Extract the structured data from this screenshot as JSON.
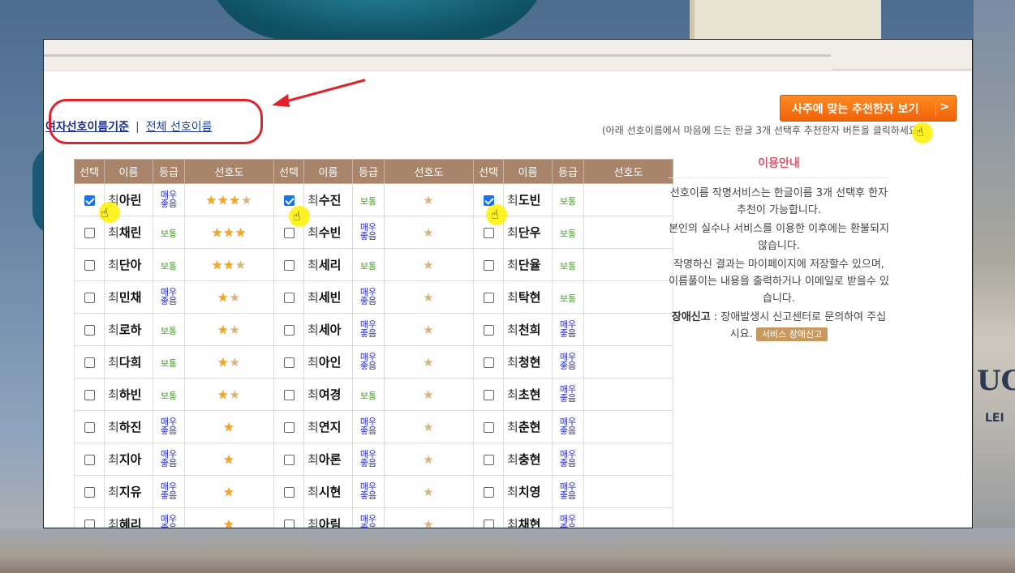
{
  "filter": {
    "current": "여자선호이름기준",
    "separator": "|",
    "all": "전체 선호이름"
  },
  "recommend": {
    "button_label": "사주에 맞는 추천한자 보기",
    "chevron": ">",
    "hint": "(아래 선호이름에서 마음에 드는 한글 3개 선택후 추천한자 버튼을 클릭하세요)"
  },
  "table": {
    "headers": [
      "선택",
      "이름",
      "등급",
      "선호도"
    ],
    "columns": [
      [
        {
          "surname": "최",
          "given": "아린",
          "grade": "매우좋음",
          "stars": 3.5,
          "checked": true
        },
        {
          "surname": "최",
          "given": "채린",
          "grade": "보통",
          "stars": 3,
          "checked": false
        },
        {
          "surname": "최",
          "given": "단아",
          "grade": "보통",
          "stars": 2.5,
          "checked": false
        },
        {
          "surname": "최",
          "given": "민채",
          "grade": "매우좋음",
          "stars": 1.5,
          "checked": false
        },
        {
          "surname": "최",
          "given": "로하",
          "grade": "보통",
          "stars": 1.5,
          "checked": false
        },
        {
          "surname": "최",
          "given": "다희",
          "grade": "보통",
          "stars": 1.5,
          "checked": false
        },
        {
          "surname": "최",
          "given": "하빈",
          "grade": "보통",
          "stars": 1.5,
          "checked": false
        },
        {
          "surname": "최",
          "given": "하진",
          "grade": "매우좋음",
          "stars": 1,
          "checked": false
        },
        {
          "surname": "최",
          "given": "지아",
          "grade": "매우좋음",
          "stars": 1,
          "checked": false
        },
        {
          "surname": "최",
          "given": "지유",
          "grade": "매우좋음",
          "stars": 1,
          "checked": false
        },
        {
          "surname": "최",
          "given": "혜리",
          "grade": "매우좋음",
          "stars": 1,
          "checked": false
        }
      ],
      [
        {
          "surname": "최",
          "given": "수진",
          "grade": "보통",
          "stars": 0.5,
          "checked": true
        },
        {
          "surname": "최",
          "given": "수빈",
          "grade": "매우좋음",
          "stars": 0.5,
          "checked": false
        },
        {
          "surname": "최",
          "given": "세리",
          "grade": "보통",
          "stars": 0.5,
          "checked": false
        },
        {
          "surname": "최",
          "given": "세빈",
          "grade": "매우좋음",
          "stars": 0.5,
          "checked": false
        },
        {
          "surname": "최",
          "given": "세아",
          "grade": "매우좋음",
          "stars": 0.5,
          "checked": false
        },
        {
          "surname": "최",
          "given": "아인",
          "grade": "매우좋음",
          "stars": 0.5,
          "checked": false
        },
        {
          "surname": "최",
          "given": "여경",
          "grade": "보통",
          "stars": 0.5,
          "checked": false
        },
        {
          "surname": "최",
          "given": "연지",
          "grade": "매우좋음",
          "stars": 0.5,
          "checked": false
        },
        {
          "surname": "최",
          "given": "아론",
          "grade": "매우좋음",
          "stars": 0.5,
          "checked": false
        },
        {
          "surname": "최",
          "given": "시현",
          "grade": "매우좋음",
          "stars": 0.5,
          "checked": false
        },
        {
          "surname": "최",
          "given": "아림",
          "grade": "매우좋음",
          "stars": 0.5,
          "checked": false
        }
      ],
      [
        {
          "surname": "최",
          "given": "도빈",
          "grade": "보통",
          "stars": 0,
          "checked": true
        },
        {
          "surname": "최",
          "given": "단우",
          "grade": "보통",
          "stars": 0,
          "checked": false
        },
        {
          "surname": "최",
          "given": "단율",
          "grade": "보통",
          "stars": 0,
          "checked": false
        },
        {
          "surname": "최",
          "given": "탁현",
          "grade": "보통",
          "stars": 0,
          "checked": false
        },
        {
          "surname": "최",
          "given": "천희",
          "grade": "매우좋음",
          "stars": 0,
          "checked": false
        },
        {
          "surname": "최",
          "given": "청현",
          "grade": "매우좋음",
          "stars": 0,
          "checked": false
        },
        {
          "surname": "최",
          "given": "초현",
          "grade": "매우좋음",
          "stars": 0,
          "checked": false
        },
        {
          "surname": "최",
          "given": "춘현",
          "grade": "매우좋음",
          "stars": 0,
          "checked": false
        },
        {
          "surname": "최",
          "given": "충현",
          "grade": "매우좋음",
          "stars": 0,
          "checked": false
        },
        {
          "surname": "최",
          "given": "치영",
          "grade": "매우좋음",
          "stars": 0,
          "checked": false
        },
        {
          "surname": "최",
          "given": "채현",
          "grade": "매우좋음",
          "stars": 0,
          "checked": false
        }
      ]
    ]
  },
  "info": {
    "title": "이용안내",
    "line1": "선호이름 작명서비스는 한글이름 3개 선택후 한자추천이 가능합니다.",
    "line2": "본인의 실수나 서비스를 이용한 이후에는 환불되지 않습니다.",
    "line3": "작명하신 결과는 마이페이지에 저장할수 있으며, 이름풀이는 내용을 출력하거나 이메일로 받을수 있습니다.",
    "report_label": "장애신고",
    "report_text": " : 장애발생시 신고센터로 문의하여 주십시요.",
    "report_button": "서비스 장애신고"
  },
  "background": {
    "letters": "UC",
    "sub_letters": "LEI"
  },
  "colors": {
    "header_brown": "#a8846a",
    "accent_orange": "#f0620a",
    "highlight_red": "#e0232b",
    "grade_good": "#4c9a30",
    "grade_best": "#2a2ec0"
  }
}
